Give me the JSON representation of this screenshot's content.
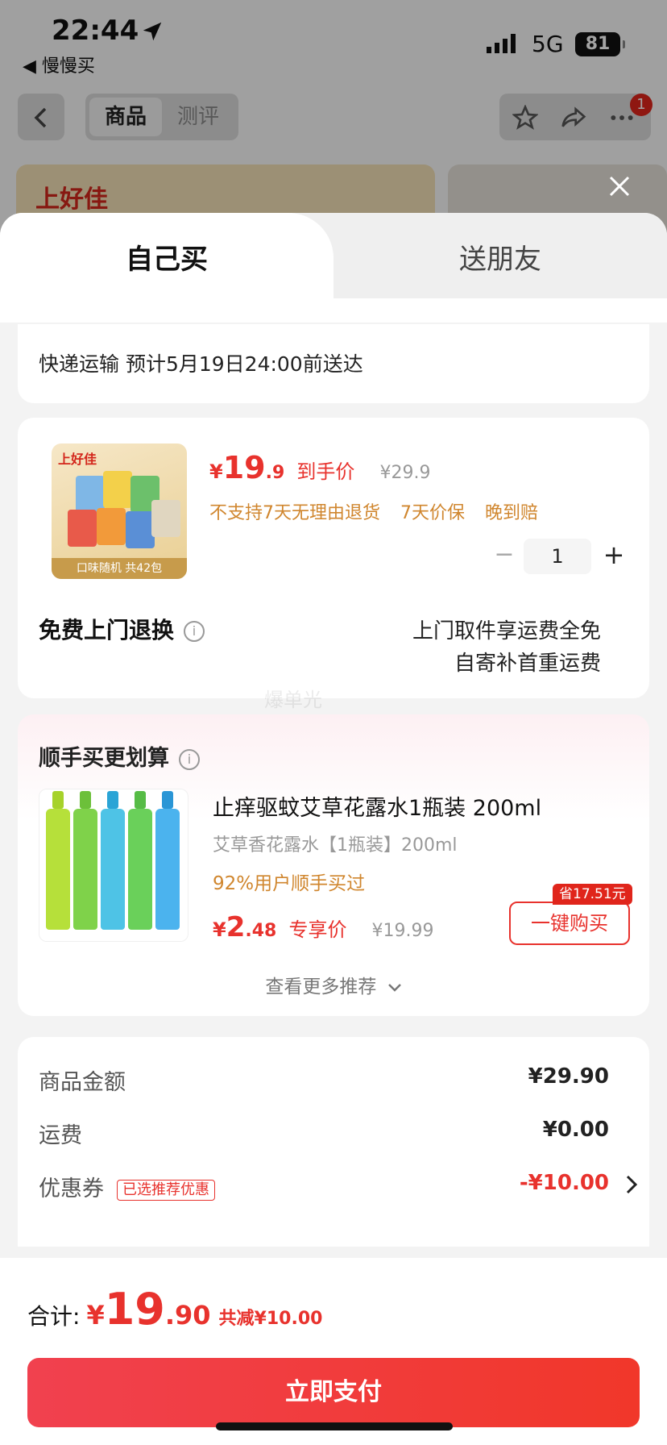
{
  "status_bar": {
    "time": "22:44",
    "back_app": "◀ 慢慢买",
    "network": "5G",
    "battery": "81"
  },
  "nav": {
    "tab_goods": "商品",
    "tab_review": "测评",
    "badge_count": "1",
    "hero_brand": "上好佳"
  },
  "sheet": {
    "tab_self": "自己买",
    "tab_friend": "送朋友",
    "delivery": "快递运输 预计5月19日24:00前送达",
    "product": {
      "thumb_brand": "上好佳",
      "thumb_caption": "口味随机 共42包",
      "price_currency": "¥",
      "price_int": "19",
      "price_dec": ".9",
      "price_tag": "到手价",
      "price_orig": "¥29.9",
      "policies": [
        "不支持7天无理由退货",
        "7天价保",
        "晚到赔"
      ],
      "quantity": "1",
      "return_title": "免费上门退换",
      "return_line1": "上门取件享运费全免",
      "return_line2": "自寄补首重运费"
    },
    "watermark": "爆单光",
    "upsell": {
      "title": "顺手买更划算",
      "name": "止痒驱蚊艾草花露水1瓶装 200ml",
      "spec": "艾草香花露水【1瓶装】200ml",
      "rate": "92%用户顺手买过",
      "price_currency": "¥",
      "price_int": "2",
      "price_dec": ".48",
      "price_tag": "专享价",
      "price_orig": "¥19.99",
      "save_badge": "省17.51元",
      "buy_label": "一键购买",
      "more_label": "查看更多推荐"
    },
    "summary": {
      "goods_label": "商品金额",
      "goods_value": "¥29.90",
      "shipping_label": "运费",
      "shipping_value": "¥0.00",
      "coupon_label": "优惠券",
      "coupon_tag": "已选推荐优惠",
      "coupon_value": "-¥10.00"
    },
    "footer": {
      "total_label": "合计:",
      "total_currency": "¥",
      "total_int": "19",
      "total_dec": ".90",
      "total_discount": "共减¥10.00",
      "pay_label": "立即支付"
    }
  },
  "colors": {
    "accent": "#e8322d",
    "policy": "#d0862e",
    "pay_button": "#f13b3a"
  }
}
